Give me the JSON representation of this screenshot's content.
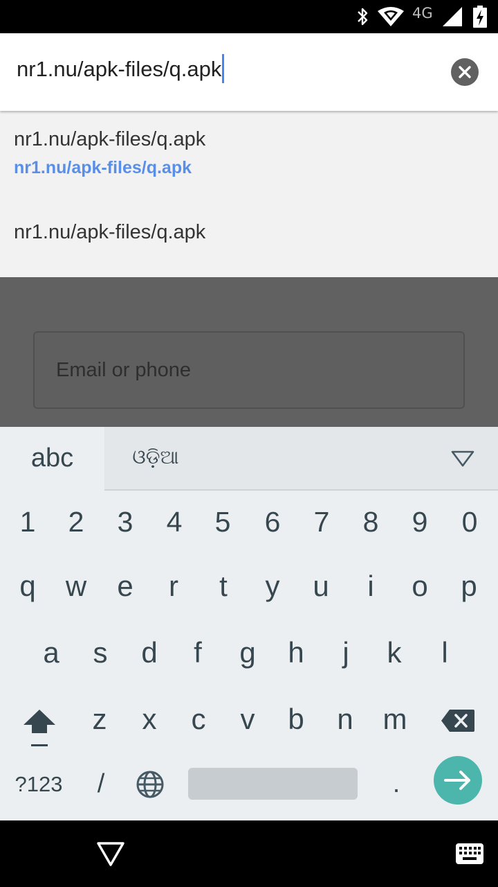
{
  "status_bar": {
    "network_type": "4G",
    "icons": [
      "bluetooth-icon",
      "wifi-icon",
      "cell-signal-icon",
      "battery-charging-icon"
    ]
  },
  "url_bar": {
    "value": "nr1.nu/apk-files/q.apk",
    "clear_icon": "clear-icon"
  },
  "suggestions": [
    {
      "title": "nr1.nu/apk-files/q.apk",
      "url": "nr1.nu/apk-files/q.apk"
    },
    {
      "title": "nr1.nu/apk-files/q.apk"
    }
  ],
  "page": {
    "email_placeholder": "Email or phone"
  },
  "keyboard": {
    "tab_abc": "abc",
    "tab_lang": "ଓଡ଼ିଆ",
    "numbers": [
      "1",
      "2",
      "3",
      "4",
      "5",
      "6",
      "7",
      "8",
      "9",
      "0"
    ],
    "row_q": [
      "q",
      "w",
      "e",
      "r",
      "t",
      "y",
      "u",
      "i",
      "o",
      "p"
    ],
    "row_a": [
      "a",
      "s",
      "d",
      "f",
      "g",
      "h",
      "j",
      "k",
      "l"
    ],
    "row_z": [
      "z",
      "x",
      "c",
      "v",
      "b",
      "n",
      "m"
    ],
    "symbols_label": "?123",
    "slash_label": "/",
    "period_label": "."
  },
  "colors": {
    "accent": "#4285f4",
    "suggestion_url": "#5a8fe8",
    "go_key": "#4db6ac",
    "keyboard_bg": "#eceff1"
  }
}
